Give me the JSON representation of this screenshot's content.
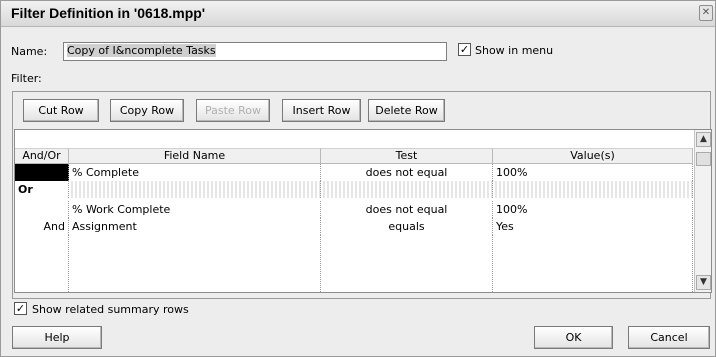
{
  "window": {
    "title": "Filter Definition in '0618.mpp'"
  },
  "name": {
    "label": "Name:",
    "value": "Copy of I&ncomplete Tasks"
  },
  "show_in_menu": {
    "label": "Show in menu",
    "checked": true
  },
  "filter": {
    "label": "Filter:"
  },
  "toolbar": {
    "cut_row": "Cut Row",
    "copy_row": "Copy Row",
    "paste_row": "Paste Row",
    "insert_row": "Insert Row",
    "delete_row": "Delete Row"
  },
  "grid": {
    "headers": [
      "And/Or",
      "Field Name",
      "Test",
      "Value(s)"
    ],
    "rows": [
      {
        "andor": "",
        "field": "% Complete",
        "test": "does not equal",
        "value": "100%"
      },
      {
        "andor": "Or",
        "field": "",
        "test": "",
        "value": ""
      },
      {
        "andor": "",
        "field": "% Work Complete",
        "test": "does not equal",
        "value": "100%"
      },
      {
        "andor": "And",
        "field": "Assignment",
        "test": "equals",
        "value": "Yes"
      }
    ]
  },
  "show_related_summary": {
    "label": "Show related summary rows",
    "checked": true
  },
  "buttons": {
    "help": "Help",
    "ok": "OK",
    "cancel": "Cancel"
  },
  "icons": {
    "close": "close-icon",
    "scroll_up": "chevron-up-icon",
    "scroll_down": "chevron-down-icon",
    "check": "checkmark-icon"
  }
}
